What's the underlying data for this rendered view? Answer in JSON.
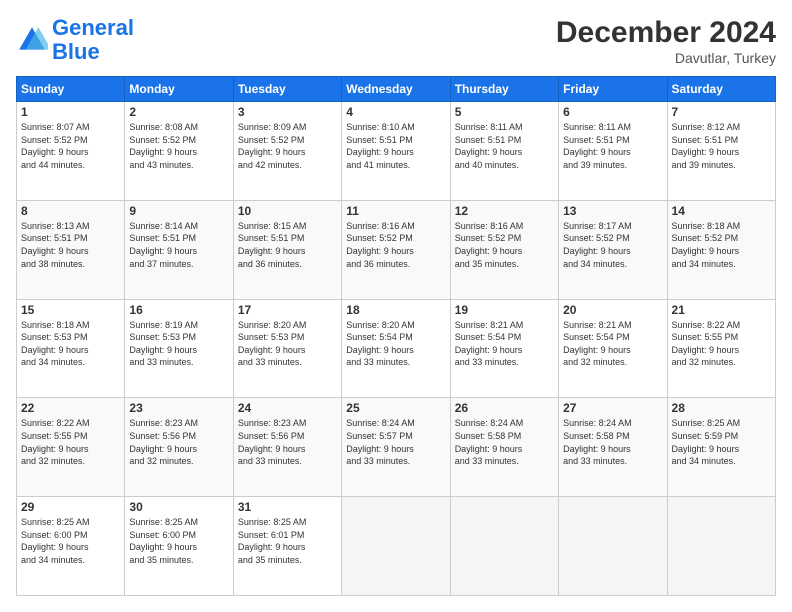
{
  "header": {
    "logo_line1": "General",
    "logo_line2": "Blue",
    "month": "December 2024",
    "location": "Davutlar, Turkey"
  },
  "weekdays": [
    "Sunday",
    "Monday",
    "Tuesday",
    "Wednesday",
    "Thursday",
    "Friday",
    "Saturday"
  ],
  "weeks": [
    [
      {
        "day": "1",
        "info": "Sunrise: 8:07 AM\nSunset: 5:52 PM\nDaylight: 9 hours\nand 44 minutes."
      },
      {
        "day": "2",
        "info": "Sunrise: 8:08 AM\nSunset: 5:52 PM\nDaylight: 9 hours\nand 43 minutes."
      },
      {
        "day": "3",
        "info": "Sunrise: 8:09 AM\nSunset: 5:52 PM\nDaylight: 9 hours\nand 42 minutes."
      },
      {
        "day": "4",
        "info": "Sunrise: 8:10 AM\nSunset: 5:51 PM\nDaylight: 9 hours\nand 41 minutes."
      },
      {
        "day": "5",
        "info": "Sunrise: 8:11 AM\nSunset: 5:51 PM\nDaylight: 9 hours\nand 40 minutes."
      },
      {
        "day": "6",
        "info": "Sunrise: 8:11 AM\nSunset: 5:51 PM\nDaylight: 9 hours\nand 39 minutes."
      },
      {
        "day": "7",
        "info": "Sunrise: 8:12 AM\nSunset: 5:51 PM\nDaylight: 9 hours\nand 39 minutes."
      }
    ],
    [
      {
        "day": "8",
        "info": "Sunrise: 8:13 AM\nSunset: 5:51 PM\nDaylight: 9 hours\nand 38 minutes."
      },
      {
        "day": "9",
        "info": "Sunrise: 8:14 AM\nSunset: 5:51 PM\nDaylight: 9 hours\nand 37 minutes."
      },
      {
        "day": "10",
        "info": "Sunrise: 8:15 AM\nSunset: 5:51 PM\nDaylight: 9 hours\nand 36 minutes."
      },
      {
        "day": "11",
        "info": "Sunrise: 8:16 AM\nSunset: 5:52 PM\nDaylight: 9 hours\nand 36 minutes."
      },
      {
        "day": "12",
        "info": "Sunrise: 8:16 AM\nSunset: 5:52 PM\nDaylight: 9 hours\nand 35 minutes."
      },
      {
        "day": "13",
        "info": "Sunrise: 8:17 AM\nSunset: 5:52 PM\nDaylight: 9 hours\nand 34 minutes."
      },
      {
        "day": "14",
        "info": "Sunrise: 8:18 AM\nSunset: 5:52 PM\nDaylight: 9 hours\nand 34 minutes."
      }
    ],
    [
      {
        "day": "15",
        "info": "Sunrise: 8:18 AM\nSunset: 5:53 PM\nDaylight: 9 hours\nand 34 minutes."
      },
      {
        "day": "16",
        "info": "Sunrise: 8:19 AM\nSunset: 5:53 PM\nDaylight: 9 hours\nand 33 minutes."
      },
      {
        "day": "17",
        "info": "Sunrise: 8:20 AM\nSunset: 5:53 PM\nDaylight: 9 hours\nand 33 minutes."
      },
      {
        "day": "18",
        "info": "Sunrise: 8:20 AM\nSunset: 5:54 PM\nDaylight: 9 hours\nand 33 minutes."
      },
      {
        "day": "19",
        "info": "Sunrise: 8:21 AM\nSunset: 5:54 PM\nDaylight: 9 hours\nand 33 minutes."
      },
      {
        "day": "20",
        "info": "Sunrise: 8:21 AM\nSunset: 5:54 PM\nDaylight: 9 hours\nand 32 minutes."
      },
      {
        "day": "21",
        "info": "Sunrise: 8:22 AM\nSunset: 5:55 PM\nDaylight: 9 hours\nand 32 minutes."
      }
    ],
    [
      {
        "day": "22",
        "info": "Sunrise: 8:22 AM\nSunset: 5:55 PM\nDaylight: 9 hours\nand 32 minutes."
      },
      {
        "day": "23",
        "info": "Sunrise: 8:23 AM\nSunset: 5:56 PM\nDaylight: 9 hours\nand 32 minutes."
      },
      {
        "day": "24",
        "info": "Sunrise: 8:23 AM\nSunset: 5:56 PM\nDaylight: 9 hours\nand 33 minutes."
      },
      {
        "day": "25",
        "info": "Sunrise: 8:24 AM\nSunset: 5:57 PM\nDaylight: 9 hours\nand 33 minutes."
      },
      {
        "day": "26",
        "info": "Sunrise: 8:24 AM\nSunset: 5:58 PM\nDaylight: 9 hours\nand 33 minutes."
      },
      {
        "day": "27",
        "info": "Sunrise: 8:24 AM\nSunset: 5:58 PM\nDaylight: 9 hours\nand 33 minutes."
      },
      {
        "day": "28",
        "info": "Sunrise: 8:25 AM\nSunset: 5:59 PM\nDaylight: 9 hours\nand 34 minutes."
      }
    ],
    [
      {
        "day": "29",
        "info": "Sunrise: 8:25 AM\nSunset: 6:00 PM\nDaylight: 9 hours\nand 34 minutes."
      },
      {
        "day": "30",
        "info": "Sunrise: 8:25 AM\nSunset: 6:00 PM\nDaylight: 9 hours\nand 35 minutes."
      },
      {
        "day": "31",
        "info": "Sunrise: 8:25 AM\nSunset: 6:01 PM\nDaylight: 9 hours\nand 35 minutes."
      },
      null,
      null,
      null,
      null
    ]
  ]
}
